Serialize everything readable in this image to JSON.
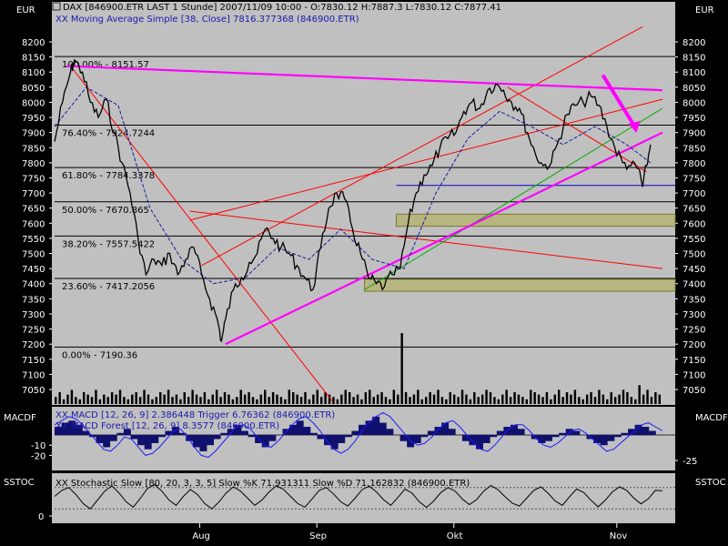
{
  "chart_data": [
    {
      "type": "line",
      "title": "DAX [846900.ETR LAST 1 Stunde] 2007/11/09 10:00 - O:7830.12 H:7887.3 L:7830.12 C:7877.41",
      "subtitle": "XX Moving Average Simple [38, Close] 7816.377368 (846900.ETR)",
      "unit_left": "EUR",
      "unit_right": "EUR",
      "ylim": [
        7000,
        8250
      ],
      "yticks": [
        7050,
        7100,
        7150,
        7200,
        7250,
        7300,
        7350,
        7400,
        7450,
        7500,
        7550,
        7600,
        7650,
        7700,
        7750,
        7800,
        7850,
        7900,
        7950,
        8000,
        8050,
        8100,
        8150,
        8200
      ],
      "x_month_labels": [
        "Aug",
        "Sep",
        "Okt",
        "Nov"
      ],
      "price_path": [
        [
          0,
          7870
        ],
        [
          2,
          8000
        ],
        [
          4,
          8100
        ],
        [
          5,
          8140
        ],
        [
          7,
          8100
        ],
        [
          9,
          8000
        ],
        [
          11,
          7950
        ],
        [
          13,
          8010
        ],
        [
          15,
          7900
        ],
        [
          17,
          7800
        ],
        [
          19,
          7700
        ],
        [
          21,
          7550
        ],
        [
          23,
          7430
        ],
        [
          25,
          7480
        ],
        [
          27,
          7460
        ],
        [
          29,
          7500
        ],
        [
          31,
          7430
        ],
        [
          33,
          7480
        ],
        [
          35,
          7520
        ],
        [
          37,
          7430
        ],
        [
          39,
          7350
        ],
        [
          41,
          7280
        ],
        [
          42,
          7210
        ],
        [
          43,
          7280
        ],
        [
          45,
          7380
        ],
        [
          47,
          7420
        ],
        [
          49,
          7470
        ],
        [
          51,
          7500
        ],
        [
          53,
          7580
        ],
        [
          55,
          7550
        ],
        [
          57,
          7520
        ],
        [
          59,
          7500
        ],
        [
          61,
          7460
        ],
        [
          63,
          7420
        ],
        [
          65,
          7380
        ],
        [
          67,
          7520
        ],
        [
          69,
          7650
        ],
        [
          71,
          7700
        ],
        [
          73,
          7680
        ],
        [
          75,
          7580
        ],
        [
          77,
          7500
        ],
        [
          79,
          7420
        ],
        [
          81,
          7400
        ],
        [
          83,
          7390
        ],
        [
          85,
          7430
        ],
        [
          87,
          7450
        ],
        [
          89,
          7600
        ],
        [
          91,
          7700
        ],
        [
          93,
          7760
        ],
        [
          95,
          7790
        ],
        [
          97,
          7850
        ],
        [
          99,
          7880
        ],
        [
          101,
          7900
        ],
        [
          103,
          7970
        ],
        [
          105,
          8000
        ],
        [
          107,
          7980
        ],
        [
          109,
          8040
        ],
        [
          111,
          8060
        ],
        [
          113,
          8040
        ],
        [
          115,
          8000
        ],
        [
          117,
          7980
        ],
        [
          119,
          7900
        ],
        [
          121,
          7830
        ],
        [
          123,
          7790
        ],
        [
          125,
          7800
        ],
        [
          127,
          7880
        ],
        [
          129,
          7960
        ],
        [
          131,
          7990
        ],
        [
          133,
          8000
        ],
        [
          135,
          8020
        ],
        [
          137,
          7990
        ],
        [
          139,
          7920
        ],
        [
          141,
          7850
        ],
        [
          143,
          7800
        ],
        [
          145,
          7790
        ],
        [
          147,
          7780
        ],
        [
          148,
          7720
        ],
        [
          149,
          7790
        ],
        [
          150,
          7860
        ]
      ],
      "moving_average_path": [
        [
          0,
          7920
        ],
        [
          8,
          8050
        ],
        [
          16,
          7990
        ],
        [
          24,
          7650
        ],
        [
          32,
          7480
        ],
        [
          40,
          7400
        ],
        [
          48,
          7420
        ],
        [
          56,
          7520
        ],
        [
          64,
          7480
        ],
        [
          72,
          7580
        ],
        [
          80,
          7480
        ],
        [
          88,
          7450
        ],
        [
          96,
          7700
        ],
        [
          104,
          7880
        ],
        [
          112,
          7970
        ],
        [
          120,
          7920
        ],
        [
          128,
          7860
        ],
        [
          136,
          7920
        ],
        [
          144,
          7860
        ],
        [
          150,
          7800
        ]
      ],
      "fibonacci_levels": [
        {
          "label": "100.00% - 8151.57",
          "value": 8151.57
        },
        {
          "label": "76.40% - 7924.7244",
          "value": 7924.7244
        },
        {
          "label": "61.80% - 7784.3378",
          "value": 7784.3378
        },
        {
          "label": "50.00% - 7670.865",
          "value": 7670.865
        },
        {
          "label": "38.20% - 7557.5422",
          "value": 7557.5422
        },
        {
          "label": "23.60% - 7417.2056",
          "value": 7417.2056
        },
        {
          "label": "0.00% - 7190.36",
          "value": 7190.36
        }
      ],
      "extra_hlines": [
        {
          "value": 7725,
          "color": "#0000cc"
        }
      ],
      "zones": [
        [
          7590,
          7630
        ],
        [
          7375,
          7415
        ]
      ],
      "trendlines": [
        {
          "color": "#ff0000",
          "from": [
            4,
            8120
          ],
          "to": [
            70,
            7010
          ]
        },
        {
          "color": "#ff0000",
          "from": [
            34,
            7640
          ],
          "to": [
            153,
            7450
          ]
        },
        {
          "color": "#ff0000",
          "from": [
            37,
            7460
          ],
          "to": [
            148,
            8250
          ]
        },
        {
          "color": "#ff0000",
          "from": [
            34,
            7610
          ],
          "to": [
            153,
            8010
          ]
        },
        {
          "color": "#ff0000",
          "from": [
            114,
            8050
          ],
          "to": [
            149,
            7770
          ]
        },
        {
          "color": "#00aa00",
          "from": [
            78,
            7380
          ],
          "to": [
            153,
            7980
          ]
        },
        {
          "color": "#ff00ff",
          "from": [
            43,
            7200
          ],
          "to": [
            153,
            7900
          ]
        },
        {
          "color": "#ff00ff",
          "from": [
            3,
            8120
          ],
          "to": [
            153,
            8040
          ]
        }
      ],
      "arrow": {
        "color": "#ff00ff",
        "from": [
          138,
          8090
        ],
        "to": [
          146,
          7920
        ]
      },
      "volume": [
        3,
        5,
        2,
        4,
        6,
        3,
        2,
        5,
        4,
        3,
        6,
        2,
        4,
        3,
        5,
        4,
        6,
        3,
        2,
        4,
        5,
        3,
        6,
        4,
        2,
        3,
        5,
        4,
        6,
        3,
        4,
        2,
        5,
        3,
        6,
        4,
        3,
        5,
        2,
        4,
        6,
        3,
        5,
        4,
        2,
        3,
        6,
        4,
        5,
        3,
        2,
        4,
        6,
        3,
        5,
        4,
        3,
        2,
        6,
        5,
        4,
        3,
        5,
        2,
        4,
        6,
        3,
        5,
        4,
        3,
        2,
        4,
        6,
        5,
        3,
        4,
        2,
        5,
        6,
        3,
        4,
        5,
        3,
        2,
        6,
        4,
        30,
        5,
        3,
        4,
        6,
        2,
        3,
        5,
        4,
        6,
        3,
        2,
        5,
        4,
        3,
        6,
        4,
        2,
        5,
        3,
        4,
        6,
        5,
        3,
        2,
        4,
        6,
        3,
        5,
        4,
        3,
        2,
        6,
        5,
        4,
        3,
        5,
        2,
        4,
        6,
        3,
        5,
        4,
        6,
        3,
        2,
        4,
        5,
        3,
        6,
        4,
        2,
        5,
        3,
        4,
        6,
        5,
        3,
        2,
        8,
        4,
        6,
        3,
        5,
        4
      ]
    },
    {
      "type": "area",
      "name": "MACDF",
      "legend_line_1": "XX MACD [12, 26, 9] 2.386448 Trigger 6.76362 (846900.ETR)",
      "legend_line_2": "XX MACD Forest [12, 26, 9] 8.3577 (846900.ETR)",
      "label": "MACDF",
      "ylim": [
        -35,
        25
      ],
      "yticks_left": [
        -20,
        -10
      ],
      "yticks_right": [
        -25
      ],
      "forest_values": [
        8,
        12,
        14,
        10,
        4,
        -2,
        -8,
        -12,
        -6,
        2,
        6,
        -4,
        -10,
        -14,
        -8,
        -2,
        4,
        8,
        2,
        -6,
        -12,
        -16,
        -10,
        -4,
        2,
        6,
        10,
        4,
        -2,
        -8,
        -12,
        -6,
        0,
        6,
        10,
        14,
        8,
        2,
        -4,
        -10,
        -14,
        -8,
        -2,
        4,
        10,
        14,
        18,
        12,
        6,
        0,
        -6,
        -12,
        -8,
        -2,
        4,
        8,
        12,
        6,
        0,
        -6,
        -10,
        -14,
        -8,
        -2,
        4,
        8,
        10,
        6,
        0,
        -4,
        -8,
        -6,
        -2,
        2,
        6,
        4,
        0,
        -4,
        -8,
        -10,
        -6,
        -2,
        2,
        6,
        10,
        8,
        4,
        0
      ],
      "macd_values": [
        10,
        14,
        18,
        16,
        10,
        2,
        -6,
        -14,
        -16,
        -10,
        -2,
        -4,
        -12,
        -20,
        -18,
        -12,
        -4,
        4,
        6,
        -2,
        -12,
        -20,
        -22,
        -16,
        -8,
        0,
        8,
        10,
        6,
        -2,
        -10,
        -12,
        -6,
        2,
        10,
        16,
        18,
        12,
        4,
        -6,
        -14,
        -18,
        -14,
        -6,
        4,
        12,
        18,
        22,
        18,
        10,
        2,
        -6,
        -10,
        -8,
        -2,
        6,
        12,
        14,
        8,
        0,
        -8,
        -14,
        -16,
        -10,
        -2,
        6,
        10,
        10,
        4,
        -4,
        -10,
        -12,
        -8,
        -2,
        4,
        6,
        2,
        -4,
        -10,
        -16,
        -14,
        -8,
        -2,
        4,
        10,
        12,
        8,
        4
      ]
    },
    {
      "type": "line",
      "name": "SSTOC",
      "legend": "XX Stochastic Slow [80, 20, 3, 3, 5] Slow %K 71.931311 Slow %D 71.162832 (846900.ETR)",
      "label": "SSTOC",
      "ylim": [
        -5,
        100
      ],
      "yticks_left": [
        0
      ],
      "stoch_values": [
        55,
        72,
        80,
        60,
        35,
        20,
        45,
        70,
        85,
        65,
        40,
        25,
        50,
        78,
        88,
        70,
        45,
        30,
        55,
        75,
        60,
        35,
        20,
        40,
        65,
        82,
        70,
        50,
        30,
        45,
        68,
        85,
        75,
        55,
        35,
        25,
        48,
        72,
        80,
        62,
        40,
        28,
        50,
        74,
        84,
        68,
        46,
        30,
        52,
        76,
        64,
        40,
        24,
        42,
        66,
        80,
        70,
        48,
        32,
        46,
        70,
        86,
        74,
        54,
        36,
        28,
        50,
        72,
        82,
        64,
        42,
        30,
        54,
        76,
        66,
        44,
        26,
        44,
        68,
        82,
        72,
        50,
        34,
        48,
        72,
        71
      ]
    }
  ]
}
